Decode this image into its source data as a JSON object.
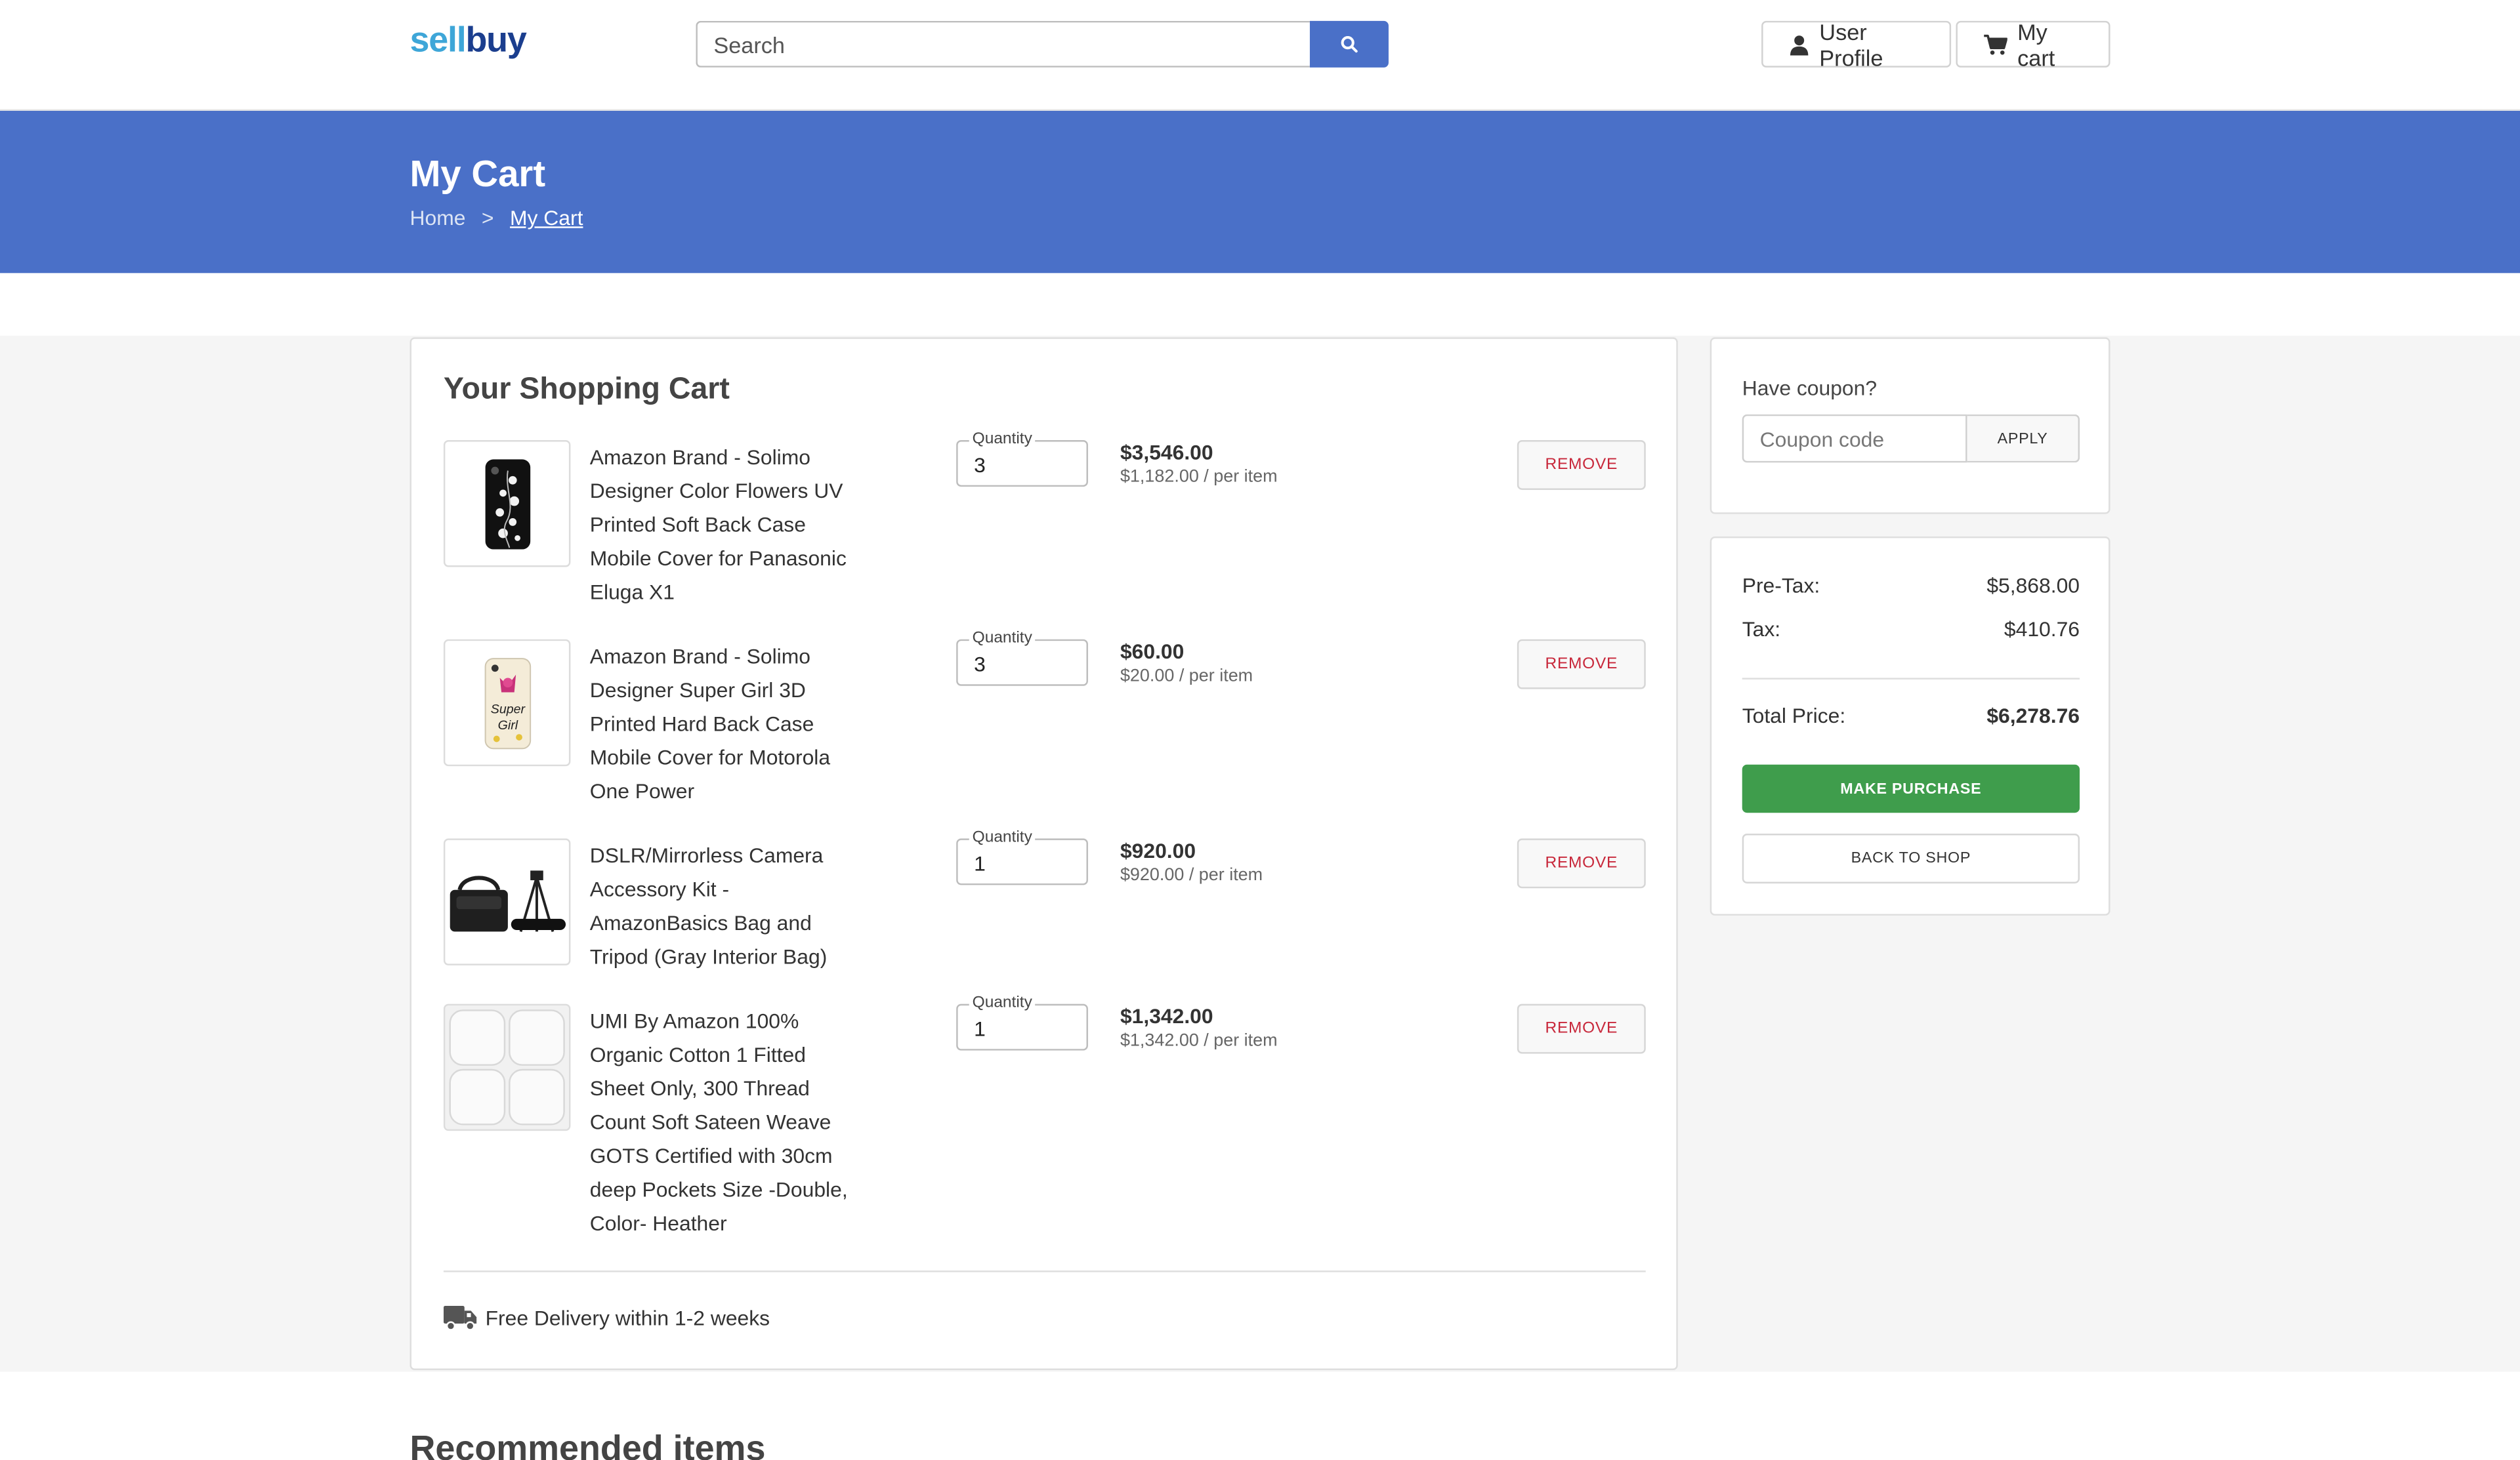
{
  "header": {
    "logo_part1": "sell",
    "logo_part2": "buy",
    "search_placeholder": "Search",
    "search_icon": "search-icon",
    "profile_label": "User Profile",
    "profile_icon": "user-icon",
    "cart_label": "My cart",
    "cart_icon": "cart-icon"
  },
  "banner": {
    "title": "My Cart",
    "breadcrumb": {
      "home": "Home",
      "separator": ">",
      "current": "My Cart"
    },
    "color": "#4a70c8"
  },
  "cart": {
    "title": "Your Shopping Cart",
    "quantity_label": "Quantity",
    "remove_label": "REMOVE",
    "items": [
      {
        "name": "Amazon Brand - Solimo Designer Color Flowers UV Printed Soft Back Case Mobile Cover for Panasonic Eluga X1",
        "quantity": "3",
        "total": "$3,546.00",
        "per_item": "$1,182.00 / per item"
      },
      {
        "name": "Amazon Brand - Solimo Designer Super Girl 3D Printed Hard Back Case Mobile Cover for Motorola One Power",
        "quantity": "3",
        "total": "$60.00",
        "per_item": "$20.00 / per item"
      },
      {
        "name": "DSLR/Mirrorless Camera Accessory Kit - AmazonBasics Bag and Tripod (Gray Interior Bag)",
        "quantity": "1",
        "total": "$920.00",
        "per_item": "$920.00 / per item"
      },
      {
        "name": "UMI By Amazon 100% Organic Cotton 1 Fitted Sheet Only, 300 Thread Count Soft Sateen Weave GOTS Certified with 30cm deep Pockets Size -Double, Color- Heather",
        "quantity": "1",
        "total": "$1,342.00",
        "per_item": "$1,342.00 / per item"
      }
    ],
    "delivery_text": "Free Delivery within 1-2 weeks",
    "delivery_icon": "truck-icon"
  },
  "coupon": {
    "label": "Have coupon?",
    "placeholder": "Coupon code",
    "apply_label": "APPLY"
  },
  "summary": {
    "pretax_label": "Pre-Tax:",
    "pretax_value": "$5,868.00",
    "tax_label": "Tax:",
    "tax_value": "$410.76",
    "total_label": "Total Price:",
    "total_value": "$6,278.76",
    "purchase_label": "MAKE PURCHASE",
    "purchase_color": "#3f9d4c",
    "back_label": "BACK TO SHOP"
  },
  "recommended_title": "Recommended items"
}
